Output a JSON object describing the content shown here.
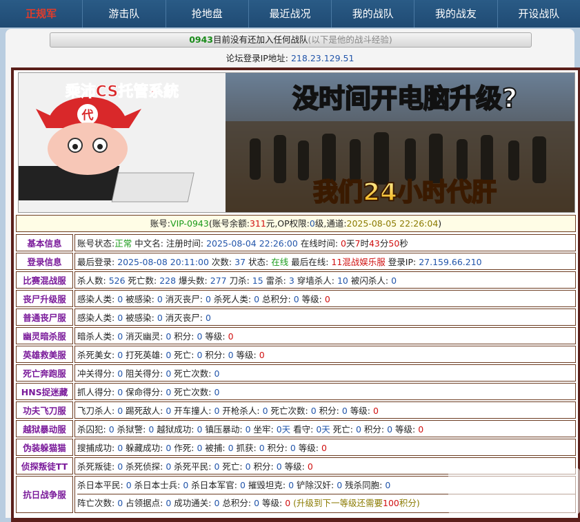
{
  "nav": {
    "logo": "正规军",
    "items": [
      "游击队",
      "抢地盘",
      "最近战况",
      "我的战队",
      "我的战友",
      "开设战队"
    ]
  },
  "notice": {
    "id": "0943",
    "text": "目前没有还加入任何战队",
    "hint": "(以下是他的战斗经验)"
  },
  "ip": {
    "label": "论坛登录IP地址:",
    "value": "218.23.129.51"
  },
  "banner": {
    "brand": "乘沛CS托管系統",
    "badge": "代",
    "headline": "没时间开电脑升级?",
    "tagline": "我们24小时代肝"
  },
  "account": {
    "label_acc": "账号:",
    "acc": "VIP-0943",
    "label_bal": "(账号余额:",
    "bal": "311",
    "unit": "元",
    "label_op": ",OP权限:",
    "op": "0",
    "op_unit": "级",
    "label_ch": ",通道:",
    "ch": "2025-08-05 22:26:04",
    "close": ")"
  },
  "rows": [
    {
      "label": "基本信息",
      "parts": [
        [
          "账号状态:",
          ""
        ],
        [
          "正常",
          "green"
        ],
        [
          " 中文名:  注册时间: ",
          ""
        ],
        [
          "2025-08-04 22:26:00",
          "blue"
        ],
        [
          " 在线时间: ",
          ""
        ],
        [
          "0",
          "red"
        ],
        [
          "天",
          ""
        ],
        [
          "7",
          "red"
        ],
        [
          "时",
          ""
        ],
        [
          "43",
          "red"
        ],
        [
          "分",
          ""
        ],
        [
          "50",
          "red"
        ],
        [
          "秒",
          ""
        ]
      ]
    },
    {
      "label": "登录信息",
      "parts": [
        [
          "最后登录: ",
          ""
        ],
        [
          "2025-08-08 20:11:00",
          "blue"
        ],
        [
          " 次数: ",
          ""
        ],
        [
          "37",
          "blue"
        ],
        [
          " 状态: ",
          ""
        ],
        [
          "在线",
          "green"
        ],
        [
          " 最后在线: ",
          ""
        ],
        [
          "11混战娱乐服",
          "red"
        ],
        [
          " 登录IP: ",
          ""
        ],
        [
          "27.159.66.210",
          "blue"
        ]
      ]
    },
    {
      "label": "比赛混战服",
      "parts": [
        [
          "杀人数: ",
          ""
        ],
        [
          "526",
          "blue"
        ],
        [
          " 死亡数: ",
          ""
        ],
        [
          "228",
          "blue"
        ],
        [
          " 爆头数: ",
          ""
        ],
        [
          "277",
          "blue"
        ],
        [
          " 刀杀: ",
          ""
        ],
        [
          "15",
          "blue"
        ],
        [
          " 雷杀: ",
          ""
        ],
        [
          "3",
          "blue"
        ],
        [
          " 穿墙杀人: ",
          ""
        ],
        [
          "10",
          "blue"
        ],
        [
          " 被闪杀人: ",
          ""
        ],
        [
          "0",
          "blue"
        ]
      ]
    },
    {
      "label": "丧尸升级服",
      "parts": [
        [
          "感染人类: ",
          ""
        ],
        [
          "0",
          "blue"
        ],
        [
          " 被感染: ",
          ""
        ],
        [
          "0",
          "blue"
        ],
        [
          " 消灭丧尸: ",
          ""
        ],
        [
          "0",
          "blue"
        ],
        [
          " 杀死人类: ",
          ""
        ],
        [
          "0",
          "blue"
        ],
        [
          " 总积分: ",
          ""
        ],
        [
          "0",
          "blue"
        ],
        [
          " 等级: ",
          ""
        ],
        [
          "0",
          "red"
        ]
      ]
    },
    {
      "label": "普通丧尸服",
      "parts": [
        [
          "感染人类: ",
          ""
        ],
        [
          "0",
          "blue"
        ],
        [
          " 被感染: ",
          ""
        ],
        [
          "0",
          "blue"
        ],
        [
          " 消灭丧尸: ",
          ""
        ],
        [
          "0",
          "blue"
        ]
      ]
    },
    {
      "label": "幽灵暗杀服",
      "parts": [
        [
          "暗杀人类: ",
          ""
        ],
        [
          "0",
          "blue"
        ],
        [
          " 消灭幽灵: ",
          ""
        ],
        [
          "0",
          "blue"
        ],
        [
          " 积分: ",
          ""
        ],
        [
          "0",
          "blue"
        ],
        [
          " 等级: ",
          ""
        ],
        [
          "0",
          "red"
        ]
      ]
    },
    {
      "label": "英雄救美服",
      "parts": [
        [
          "杀死美女: ",
          ""
        ],
        [
          "0",
          "blue"
        ],
        [
          " 打死英雄: ",
          ""
        ],
        [
          "0",
          "blue"
        ],
        [
          " 死亡: ",
          ""
        ],
        [
          "0",
          "blue"
        ],
        [
          " 积分: ",
          ""
        ],
        [
          "0",
          "blue"
        ],
        [
          " 等级: ",
          ""
        ],
        [
          "0",
          "red"
        ]
      ]
    },
    {
      "label": "死亡奔跑服",
      "parts": [
        [
          "冲关得分: ",
          ""
        ],
        [
          "0",
          "blue"
        ],
        [
          " 阻关得分: ",
          ""
        ],
        [
          "0",
          "blue"
        ],
        [
          " 死亡次数: ",
          ""
        ],
        [
          "0",
          "blue"
        ]
      ]
    },
    {
      "label": "HNS捉迷藏",
      "parts": [
        [
          "抓人得分: ",
          ""
        ],
        [
          "0",
          "blue"
        ],
        [
          " 保命得分: ",
          ""
        ],
        [
          "0",
          "blue"
        ],
        [
          " 死亡次数: ",
          ""
        ],
        [
          "0",
          "blue"
        ]
      ]
    },
    {
      "label": "功夫飞刀服",
      "parts": [
        [
          "飞刀杀人: ",
          ""
        ],
        [
          "0",
          "blue"
        ],
        [
          " 踢死敌人: ",
          ""
        ],
        [
          "0",
          "blue"
        ],
        [
          " 开车撞人: ",
          ""
        ],
        [
          "0",
          "blue"
        ],
        [
          " 开枪杀人: ",
          ""
        ],
        [
          "0",
          "blue"
        ],
        [
          " 死亡次数: ",
          ""
        ],
        [
          "0",
          "blue"
        ],
        [
          " 积分: ",
          ""
        ],
        [
          "0",
          "blue"
        ],
        [
          " 等级: ",
          ""
        ],
        [
          "0",
          "red"
        ]
      ]
    },
    {
      "label": "越狱暴动服",
      "parts": [
        [
          "杀囚犯: ",
          ""
        ],
        [
          "0",
          "blue"
        ],
        [
          " 杀狱警: ",
          ""
        ],
        [
          "0",
          "blue"
        ],
        [
          " 越狱成功: ",
          ""
        ],
        [
          "0",
          "blue"
        ],
        [
          " 镇压暴动: ",
          ""
        ],
        [
          "0",
          "blue"
        ],
        [
          " 坐牢: ",
          ""
        ],
        [
          "0天",
          "blue"
        ],
        [
          " 看守: ",
          ""
        ],
        [
          "0天",
          "blue"
        ],
        [
          " 死亡: ",
          ""
        ],
        [
          "0",
          "blue"
        ],
        [
          " 积分: ",
          ""
        ],
        [
          "0",
          "blue"
        ],
        [
          " 等级: ",
          ""
        ],
        [
          "0",
          "red"
        ]
      ]
    },
    {
      "label": "伪装躲猫猫",
      "parts": [
        [
          "搜捕成功: ",
          ""
        ],
        [
          "0",
          "blue"
        ],
        [
          " 躲藏成功: ",
          ""
        ],
        [
          "0",
          "blue"
        ],
        [
          " 作死: ",
          ""
        ],
        [
          "0",
          "blue"
        ],
        [
          " 被捕: ",
          ""
        ],
        [
          "0",
          "blue"
        ],
        [
          " 抓获: ",
          ""
        ],
        [
          "0",
          "blue"
        ],
        [
          " 积分: ",
          ""
        ],
        [
          "0",
          "blue"
        ],
        [
          " 等级: ",
          ""
        ],
        [
          "0",
          "red"
        ]
      ]
    },
    {
      "label": "侦探叛徒TT",
      "parts": [
        [
          "杀死叛徒: ",
          ""
        ],
        [
          "0",
          "blue"
        ],
        [
          " 杀死侦探: ",
          ""
        ],
        [
          "0",
          "blue"
        ],
        [
          " 杀死平民: ",
          ""
        ],
        [
          "0",
          "blue"
        ],
        [
          " 死亡: ",
          ""
        ],
        [
          "0",
          "blue"
        ],
        [
          " 积分: ",
          ""
        ],
        [
          "0",
          "blue"
        ],
        [
          " 等级: ",
          ""
        ],
        [
          "0",
          "red"
        ]
      ]
    }
  ],
  "war": {
    "label": "抗日战争服",
    "line1": [
      [
        "杀日本平民: ",
        ""
      ],
      [
        "0",
        "blue"
      ],
      [
        " 杀日本士兵: ",
        ""
      ],
      [
        "0",
        "blue"
      ],
      [
        " 杀日本军官: ",
        ""
      ],
      [
        "0",
        "blue"
      ],
      [
        " 摧毁坦克: ",
        ""
      ],
      [
        "0",
        "blue"
      ],
      [
        " 铲除汉奸: ",
        ""
      ],
      [
        "0",
        "blue"
      ],
      [
        " 残杀同胞: ",
        ""
      ],
      [
        "0",
        "blue"
      ]
    ],
    "line2": [
      [
        "阵亡次数: ",
        ""
      ],
      [
        "0",
        "blue"
      ],
      [
        " 占领据点: ",
        ""
      ],
      [
        "0",
        "blue"
      ],
      [
        " 成功通关: ",
        ""
      ],
      [
        "0",
        "blue"
      ],
      [
        " 总积分: ",
        ""
      ],
      [
        "0",
        "blue"
      ],
      [
        " 等级: ",
        ""
      ],
      [
        "0",
        "red"
      ],
      [
        " (升级到下一等级还需要",
        "olive"
      ],
      [
        "100",
        "red"
      ],
      [
        "积分)",
        "olive"
      ]
    ]
  },
  "colors": {
    "nav": "#1f4a73",
    "frame": "#5a1f1a",
    "label": "#7a1a9a",
    "value": "#2255aa",
    "alert": "#d01010"
  }
}
